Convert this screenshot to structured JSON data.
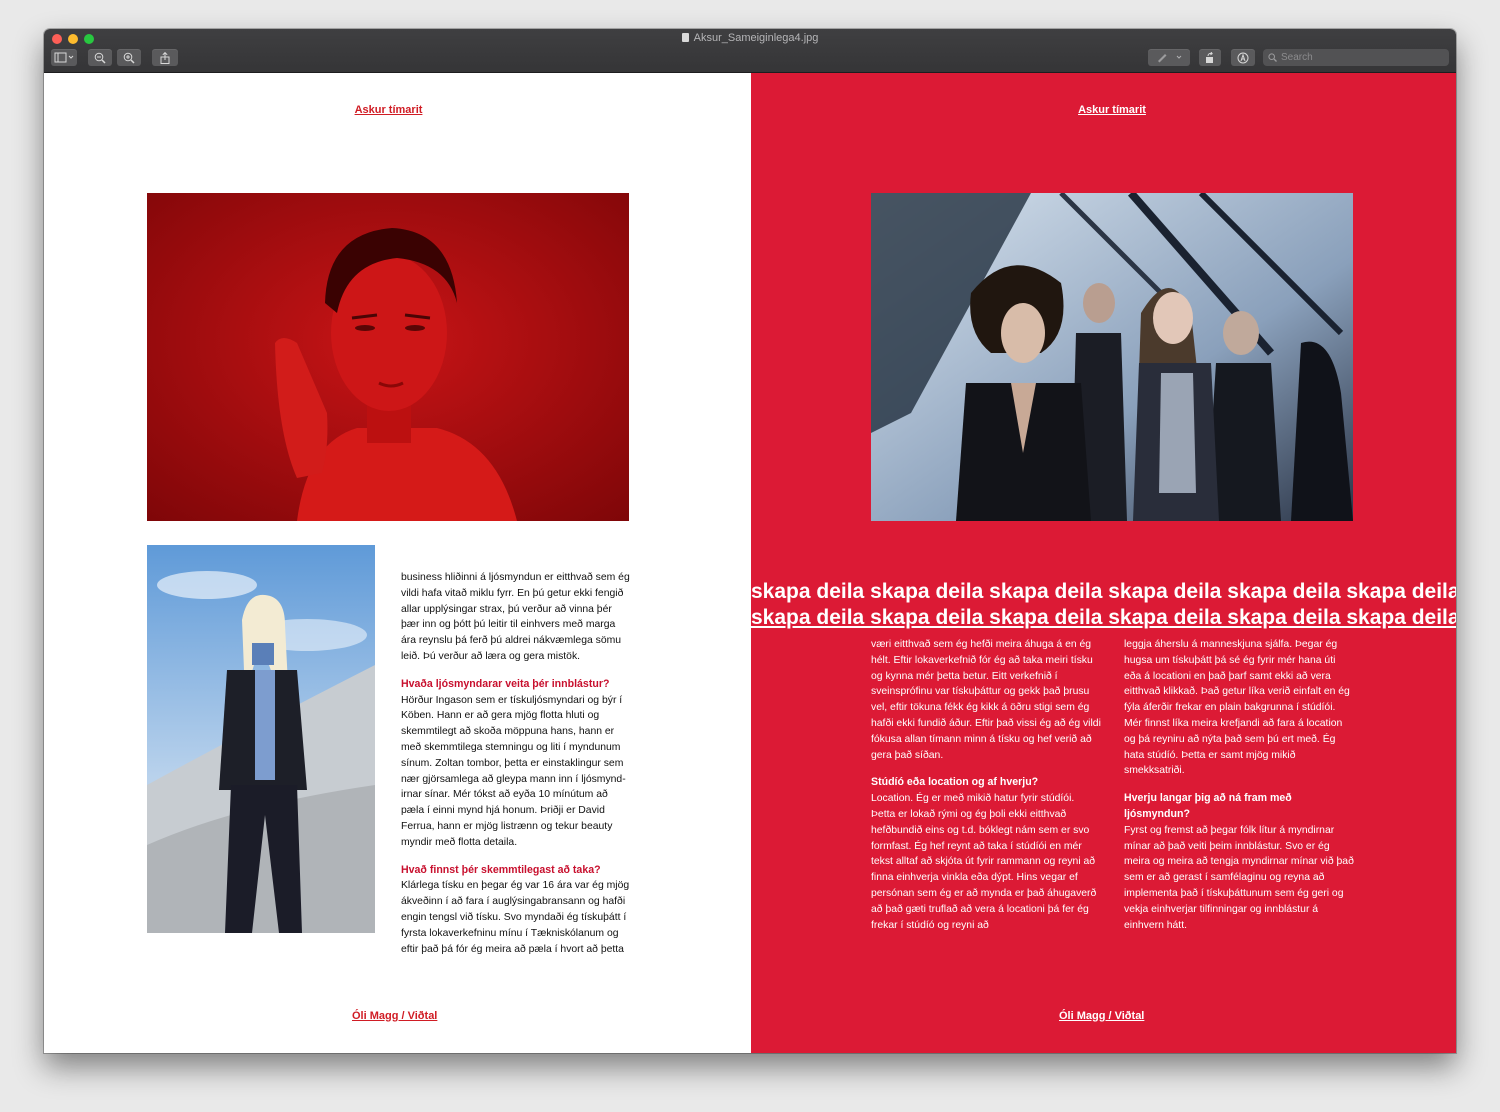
{
  "window": {
    "title": "Aksur_Sameiginlega4.jpg"
  },
  "toolbar": {
    "search_placeholder": "Search"
  },
  "left_page": {
    "header": "Askur tímarit",
    "footer": "Óli Magg  / Viðtal",
    "intro_text": "business hliðinni á ljósmyndun er eitthvað sem ég vildi hafa vitað miklu fyrr. En þú getur ekki fengið allar upplýsingar strax, þú verður að vinna þér þær inn og þótt þú leitir til einhvers með marga ára reynslu þá ferð þú aldrei nákvæmlega sömu leið. Þú verður að læra og gera mistök.",
    "q1": "Hvaða ljósmyndarar veita þér innblástur?",
    "a1": "Hörður Ingason sem er tískuljósmyndari og býr í Köben. Hann er að gera mjög flotta hluti og skemmtilegt að skoða möppuna hans, hann er með skemmtilega stemningu og liti í myndunum sínum. Zoltan tombor, þetta er einstaklingur sem nær gjörsamlega að gleypa mann inn í ljósmynd-irnar sínar. Mér tókst að eyða 10 mínútum að pæla í einni mynd hjá honum. Þriðji er David Ferrua, hann er mjög listrænn og tekur beauty myndir með flotta detaila.",
    "q2": "Hvað finnst þér skemmtilegast að taka?",
    "a2": "Klárlega tísku en þegar ég var 16 ára var ég mjög ákveðinn í að fara í auglýsingabransann og hafði engin tengsl við tísku. Svo myndaði ég tískuþátt í fyrsta lokaverkefninu mínu í Tækniskólanum og eftir það þá fór ég meira að pæla í hvort að þetta"
  },
  "right_page": {
    "header": "Askur tímarit",
    "footer": "Óli Magg  / Viðtal",
    "banner_line1": "skapa deila skapa deila skapa deila skapa deila skapa deila skapa deila skapa d",
    "banner_line2": "skapa deila skapa deila skapa deila skapa deila skapa deila skapa deila skapa d",
    "col1_text": "væri eitthvað sem ég hefði meira áhuga á en ég hélt. Eftir lokaverkefnið fór ég að taka meiri tísku og kynna mér þetta betur. Eitt verkefnið í sveinsprófinu var tískuþáttur og gekk það þrusu vel, eftir tökuna fékk ég kikk á öðru stigi sem ég hafði ekki fundið áður. Eftir það vissi ég að ég vildi fókusa allan tímann minn á tísku og hef verið að gera það síðan.",
    "col1_q": "Stúdíó eða location og af hverju?",
    "col1_a": "Location. Ég er með mikið hatur fyrir stúdíói. Þetta er lokað rými og ég þoli ekki eitthvað hefðbundið eins og t.d. bóklegt nám sem er svo formfast. Ég hef reynt að taka í stúdíói en mér tekst alltaf að skjóta út fyrir rammann og reyni að finna einhverja vinkla eða dýpt. Hins vegar ef persónan sem ég er að mynda er það áhugaverð að það gæti truflað að vera á locationi þá fer ég frekar í stúdíó og reyni að",
    "col2_text": "leggja áherslu á manneskjuna sjálfa. Þegar ég hugsa um tískuþátt þá sé ég fyrir mér hana úti eða á locationi en það þarf samt ekki að vera eitthvað klikkað. Það getur líka verið einfalt en ég fýla áferðir frekar en plain bakgrunna í stúdíói. Mér finnst líka meira krefjandi að fara á location og þá reyniru að nýta það sem þú ert með. Ég hata stúdíó. Þetta er samt mjög mikið smekksatriði.",
    "col2_q": "Hverju langar þig að ná fram með ljósmyndun?",
    "col2_a": "Fyrst og fremst að þegar fólk lítur á myndirnar mínar að það veiti þeim innblástur. Svo er ég meira og meira að tengja myndirnar mínar við það sem er að gerast í samfélaginu og reyna að implementa það í tískuþáttunum sem ég geri og vekja einhverjar tilfinningar og innblástur á einhvern hátt."
  },
  "colors": {
    "accent_red": "#dc1a35",
    "heading_red": "#c8102e"
  }
}
